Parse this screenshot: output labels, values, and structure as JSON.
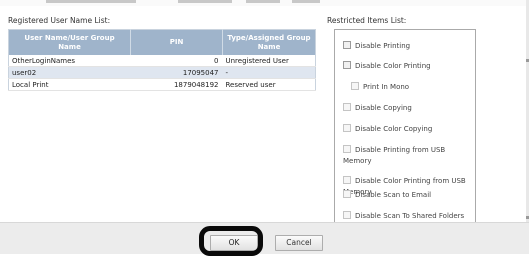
{
  "labels": {
    "registered_users": "Registered User Name List:",
    "restricted_items": "Restricted Items List:"
  },
  "users_table": {
    "headers": [
      "User Name/User Group Name",
      "PIN",
      "Type/Assigned Group Name"
    ],
    "rows": [
      {
        "name": "OtherLoginNames",
        "pin": "0",
        "type": "Unregistered User",
        "selected": false
      },
      {
        "name": "user02",
        "pin": "17095047",
        "type": "-",
        "selected": true
      },
      {
        "name": "Local Print",
        "pin": "1879048192",
        "type": "Reserved user",
        "selected": false
      }
    ]
  },
  "restricted_items": [
    {
      "label": "Disable Printing",
      "enabled": true
    },
    {
      "label": "Disable Color Printing",
      "enabled": true
    },
    {
      "label": "Print In Mono",
      "enabled": false,
      "indent": true
    },
    {
      "label": "Disable Copying",
      "enabled": false
    },
    {
      "label": "Disable Color Copying",
      "enabled": false
    },
    {
      "label": "Disable Printing from USB Memory",
      "enabled": false
    },
    {
      "label": "Disable Color Printing from USB Memory",
      "enabled": false
    },
    {
      "label": "Disable Scan to Email",
      "enabled": false
    },
    {
      "label": "Disable Scan To Shared Folders",
      "enabled": false
    }
  ],
  "buttons": {
    "ok": "OK",
    "cancel": "Cancel"
  },
  "colors": {
    "table_header": "#9fb4cb",
    "selected_row": "#dfe6f0",
    "highlight_ring": "#0a0a0a"
  }
}
